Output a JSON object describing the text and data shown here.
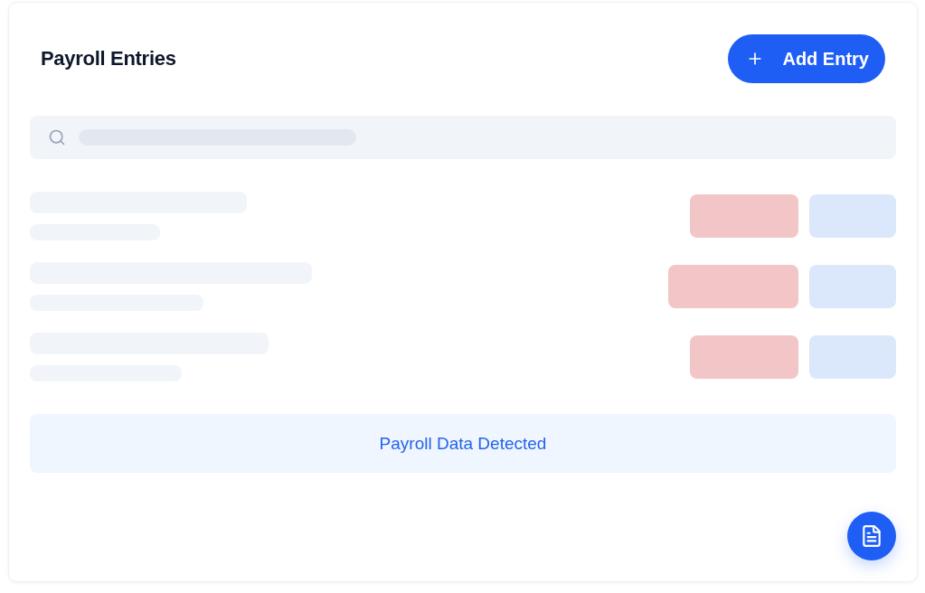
{
  "header": {
    "title": "Payroll Entries",
    "add_button": {
      "label": "Add Entry"
    }
  },
  "loading": true,
  "notice": {
    "text": "Payroll Data Detected"
  }
}
